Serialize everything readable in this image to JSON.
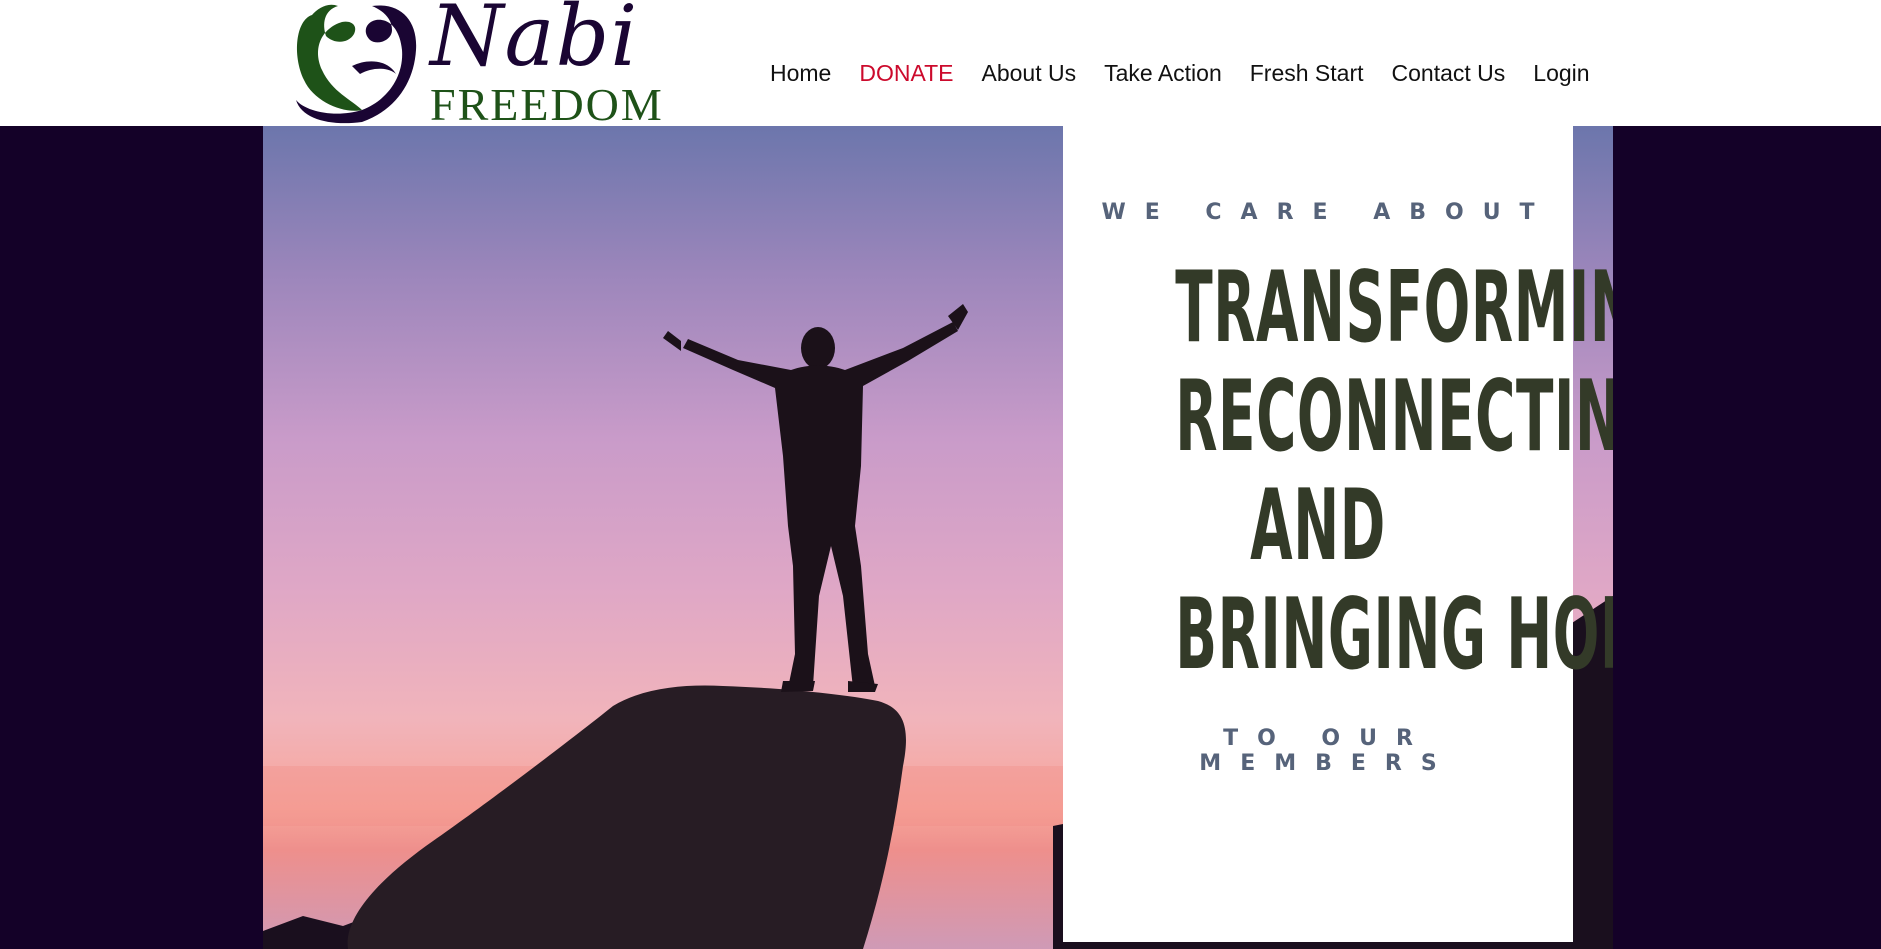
{
  "header": {
    "logo": {
      "name_line1": "Nabi",
      "name_line2": "FREEDOM"
    },
    "nav": [
      {
        "label": "Home"
      },
      {
        "label": "DONATE"
      },
      {
        "label": "About Us"
      },
      {
        "label": "Take Action"
      },
      {
        "label": "Fresh Start"
      },
      {
        "label": "Contact Us"
      },
      {
        "label": "Login"
      }
    ]
  },
  "hero": {
    "kicker": "WE CARE ABOUT",
    "headline": [
      "TRANSFORMING,",
      "RECONNECTING,",
      "AND",
      "BRINGING HOPE"
    ],
    "footer": "TO OUR MEMBERS"
  },
  "colors": {
    "page_background": "#140128",
    "header_background": "#ffffff",
    "nav_text": "#111111",
    "donate_accent": "#cc0a2c",
    "logo_purple": "#1a0533",
    "logo_green": "#1e5218",
    "headline_text": "#333a28",
    "kicker_text": "#56637a"
  },
  "icons": {
    "logo_mark": "arabic-calligraphy-heart-icon",
    "hero_image": "silhouette-on-rock-at-sunset"
  }
}
